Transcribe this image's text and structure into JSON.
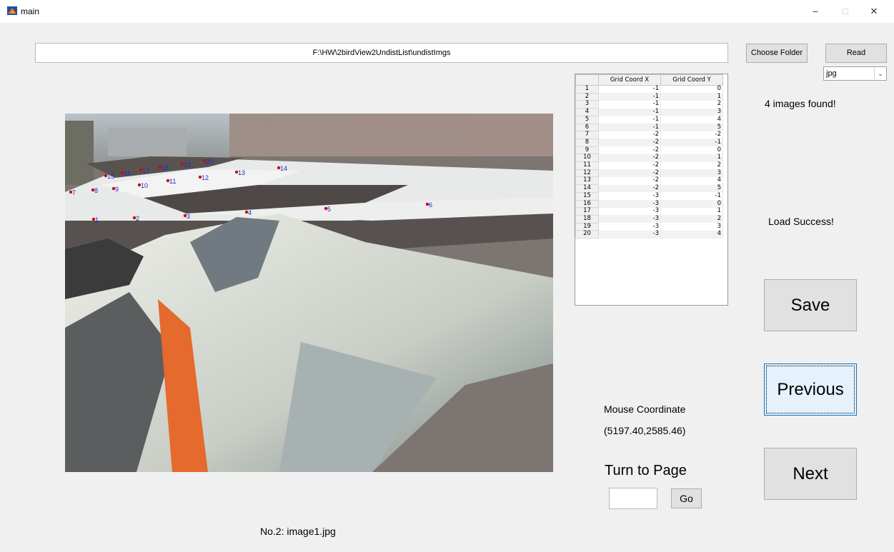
{
  "window": {
    "title": "main",
    "minimize": "–",
    "maximize": "□",
    "close": "✕"
  },
  "toolbar": {
    "path": "F:\\HW\\2birdView2UndistList\\undistImgs",
    "choose_folder": "Choose Folder",
    "read": "Read",
    "format_selected": "jpg"
  },
  "status": {
    "images_found": "4 images found!",
    "load_status": "Load Success!"
  },
  "table": {
    "headers": [
      "Grid Coord X",
      "Grid Coord Y"
    ],
    "rows": [
      {
        "idx": "1",
        "x": "-1",
        "y": "0"
      },
      {
        "idx": "2",
        "x": "-1",
        "y": "1"
      },
      {
        "idx": "3",
        "x": "-1",
        "y": "2"
      },
      {
        "idx": "4",
        "x": "-1",
        "y": "3"
      },
      {
        "idx": "5",
        "x": "-1",
        "y": "4"
      },
      {
        "idx": "6",
        "x": "-1",
        "y": "5"
      },
      {
        "idx": "7",
        "x": "-2",
        "y": "-2"
      },
      {
        "idx": "8",
        "x": "-2",
        "y": "-1"
      },
      {
        "idx": "9",
        "x": "-2",
        "y": "0"
      },
      {
        "idx": "10",
        "x": "-2",
        "y": "1"
      },
      {
        "idx": "11",
        "x": "-2",
        "y": "2"
      },
      {
        "idx": "12",
        "x": "-2",
        "y": "3"
      },
      {
        "idx": "13",
        "x": "-2",
        "y": "4"
      },
      {
        "idx": "14",
        "x": "-2",
        "y": "5"
      },
      {
        "idx": "15",
        "x": "-3",
        "y": "-1"
      },
      {
        "idx": "16",
        "x": "-3",
        "y": "0"
      },
      {
        "idx": "17",
        "x": "-3",
        "y": "1"
      },
      {
        "idx": "18",
        "x": "-3",
        "y": "2"
      },
      {
        "idx": "19",
        "x": "-3",
        "y": "3"
      },
      {
        "idx": "20",
        "x": "-3",
        "y": "4"
      }
    ]
  },
  "buttons": {
    "save": "Save",
    "previous": "Previous",
    "next": "Next",
    "go": "Go"
  },
  "mouse": {
    "label": "Mouse Coordinate",
    "value": "(5197.40,2585.46)"
  },
  "page": {
    "label": "Turn to Page",
    "input_value": ""
  },
  "image": {
    "caption": "No.2: image1.jpg"
  },
  "markers": [
    "1",
    "2",
    "3",
    "4",
    "5",
    "6",
    "7",
    "8",
    "9",
    "10",
    "11",
    "12",
    "13",
    "14",
    "15",
    "16",
    "17",
    "18",
    "19",
    "20"
  ],
  "colors": {
    "marker_dot": "#d0021b",
    "marker_label": "#1a2bd6",
    "focus_border": "#0078d7"
  }
}
